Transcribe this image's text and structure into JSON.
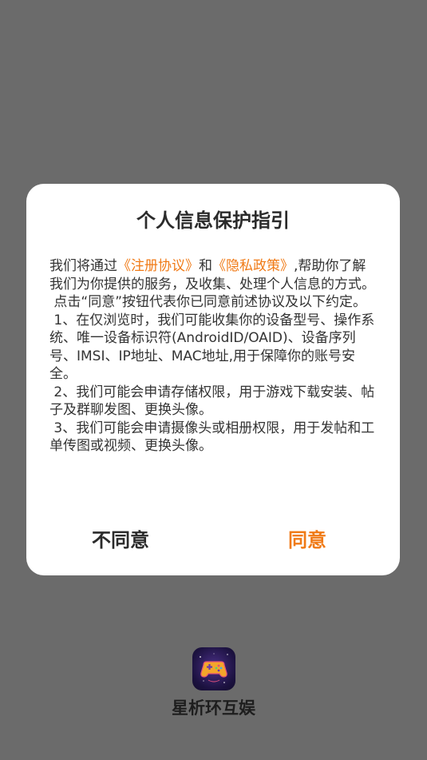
{
  "dialog": {
    "title": "个人信息保护指引",
    "intro": {
      "prefix": "我们将通过",
      "link1": "《注册协议》",
      "middle": "和",
      "link2": "《隐私政策》",
      "suffix": ",帮助你了解我们为你提供的服务，及收集、处理个人信息的方式。"
    },
    "paragraphs": [
      " 点击“同意”按钮代表你已同意前述协议及以下约定。",
      " 1、在仅浏览时，我们可能收集你的设备型号、操作系统、唯一设备标识符(AndroidID/OAID)、设备序列号、IMSI、IP地址、MAC地址,用于保障你的账号安全。",
      " 2、我们可能会申请存储权限，用于游戏下载安装、帖子及群聊发图、更换头像。",
      " 3、我们可能会申请摄像头或相册权限，用于发帖和工单传图或视频、更换头像。"
    ],
    "disagree_label": "不同意",
    "agree_label": "同意"
  },
  "app": {
    "name": "星析环互娱",
    "logo_icon": "gamepad-icon"
  },
  "colors": {
    "accent": "#f07a16",
    "backdrop": "#6b6b6b",
    "text": "#333333"
  }
}
